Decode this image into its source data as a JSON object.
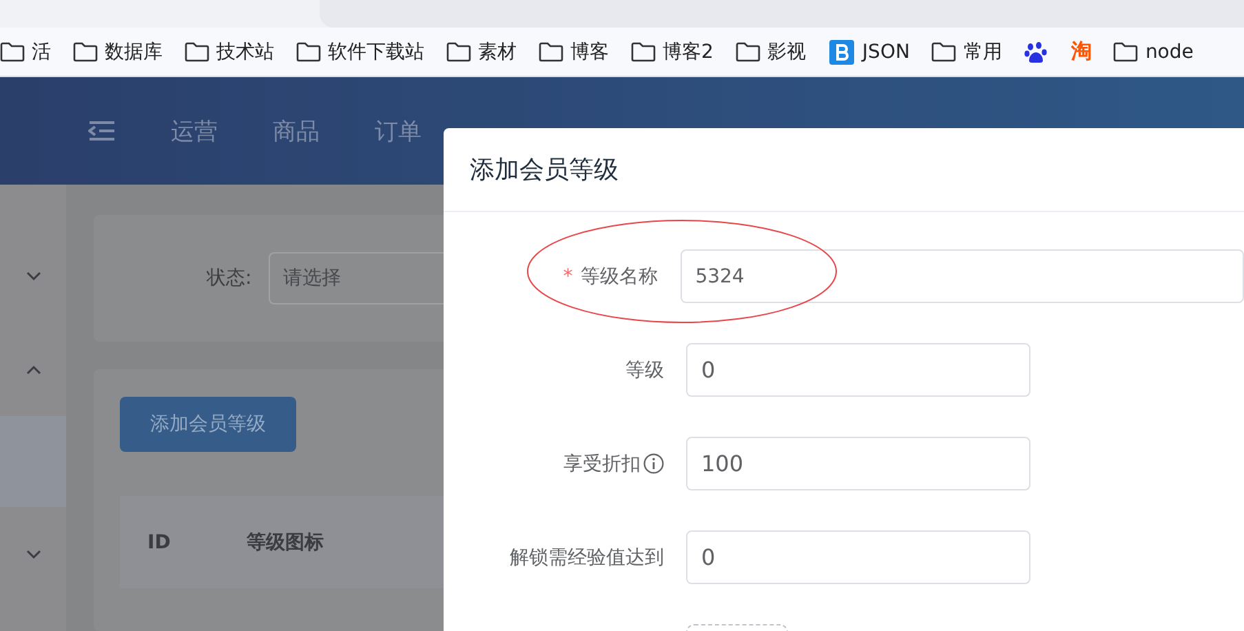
{
  "bookmarks": [
    {
      "kind": "folder",
      "label": "活"
    },
    {
      "kind": "folder",
      "label": "数据库"
    },
    {
      "kind": "folder",
      "label": "技术站"
    },
    {
      "kind": "folder",
      "label": "软件下载站"
    },
    {
      "kind": "folder",
      "label": "素材"
    },
    {
      "kind": "folder",
      "label": "博客"
    },
    {
      "kind": "folder",
      "label": "博客2"
    },
    {
      "kind": "folder",
      "label": "影视"
    },
    {
      "kind": "brand",
      "label": "JSON"
    },
    {
      "kind": "folder",
      "label": "常用"
    },
    {
      "kind": "paw"
    },
    {
      "kind": "text",
      "label": "淘"
    },
    {
      "kind": "folder",
      "label": "node"
    }
  ],
  "nav": {
    "items": [
      {
        "label": "运营"
      },
      {
        "label": "商品"
      },
      {
        "label": "订单"
      }
    ]
  },
  "sidebar": {
    "groups": [
      {
        "expanded": false
      },
      {
        "expanded": true,
        "items": [
          {
            "selected": true
          }
        ]
      },
      {
        "expanded": false
      }
    ]
  },
  "filter": {
    "label": "状态:",
    "placeholder": "请选择"
  },
  "add_button": "添加会员等级",
  "table": {
    "columns": [
      "ID",
      "等级图标"
    ]
  },
  "modal": {
    "title": "添加会员等级",
    "fields": [
      {
        "kind": "text",
        "label": "等级名称",
        "required_mark": "*",
        "value": "5324"
      },
      {
        "kind": "number",
        "label": "等级",
        "value": "0"
      },
      {
        "kind": "number",
        "label": "享受折扣",
        "info": true,
        "value": "100"
      },
      {
        "kind": "number",
        "label": "解锁需经验值达到",
        "value": "0"
      },
      {
        "kind": "upload"
      }
    ],
    "annotations": [
      {
        "kind": "ellipse"
      }
    ]
  }
}
